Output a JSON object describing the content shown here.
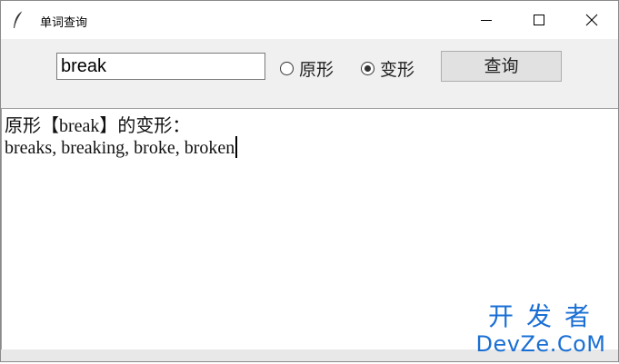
{
  "window": {
    "title": "单词查询"
  },
  "toolbar": {
    "word_value": "break",
    "radio_base_label": "原形",
    "radio_inflect_label": "变形",
    "radio_selected": "变形",
    "query_button_label": "查询"
  },
  "result": {
    "line1": "原形【break】的变形：",
    "line2": "breaks, breaking, broke, broken"
  },
  "watermark": {
    "line1": "开发者",
    "line2": "DevZe.CoM"
  },
  "colors": {
    "watermark": "#1a6fd4",
    "button_face": "#e1e1e1",
    "window_bg": "#f0f0f0"
  }
}
